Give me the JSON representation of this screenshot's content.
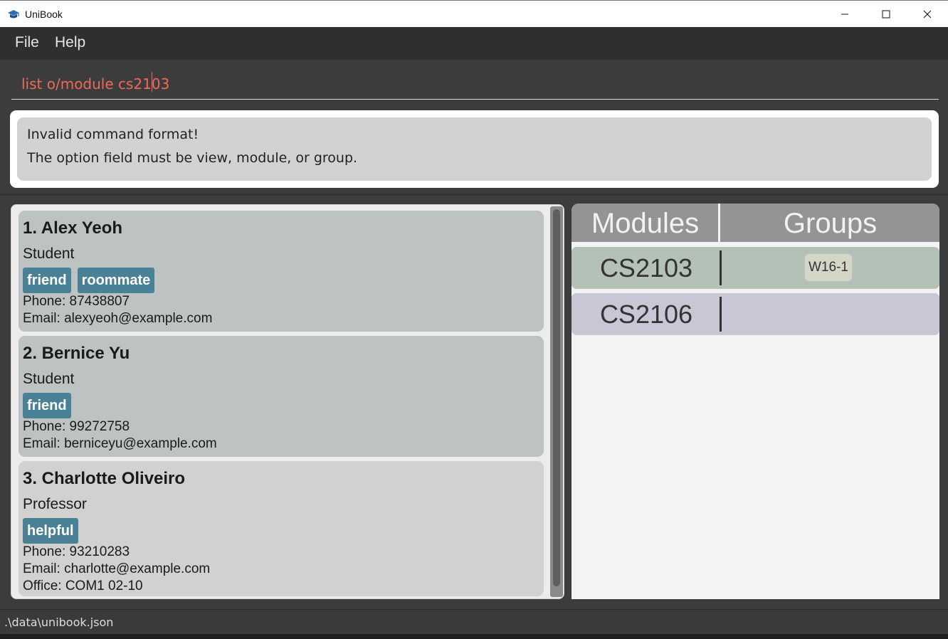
{
  "window": {
    "title": "UniBook"
  },
  "menu": {
    "items": [
      "File",
      "Help"
    ]
  },
  "command": {
    "value": "list o/module cs2103"
  },
  "result": {
    "lines": [
      "Invalid command format!",
      "The option field must be view, module, or group."
    ]
  },
  "people": [
    {
      "name": "1.  Alex Yeoh",
      "role": "Student",
      "tags": [
        "friend",
        "roommate"
      ],
      "phone": "Phone: 87438807",
      "email": "Email: alexyeoh@example.com"
    },
    {
      "name": "2.  Bernice Yu",
      "role": "Student",
      "tags": [
        "friend"
      ],
      "phone": "Phone: 99272758",
      "email": "Email: berniceyu@example.com"
    },
    {
      "name": "3.  Charlotte Oliveiro",
      "role": "Professor",
      "tags": [
        "helpful"
      ],
      "phone": "Phone: 93210283",
      "email": "Email: charlotte@example.com",
      "office": "Office: COM1 02-10"
    }
  ],
  "modules_panel": {
    "headers": {
      "modules": "Modules",
      "groups": "Groups"
    },
    "rows": [
      {
        "code": "CS2103",
        "groups": [
          "W16-1"
        ]
      },
      {
        "code": "CS2106",
        "groups": []
      }
    ]
  },
  "status": {
    "path": ".\\data\\unibook.json"
  },
  "colors": {
    "command_text": "#ee6a5a",
    "tag_bg": "#4a8196",
    "card_bg": "#bcc3c2",
    "card_alt_bg": "#d3d1cf",
    "module_row1": "#b3c1b6",
    "module_row2": "#c8c7d5"
  }
}
